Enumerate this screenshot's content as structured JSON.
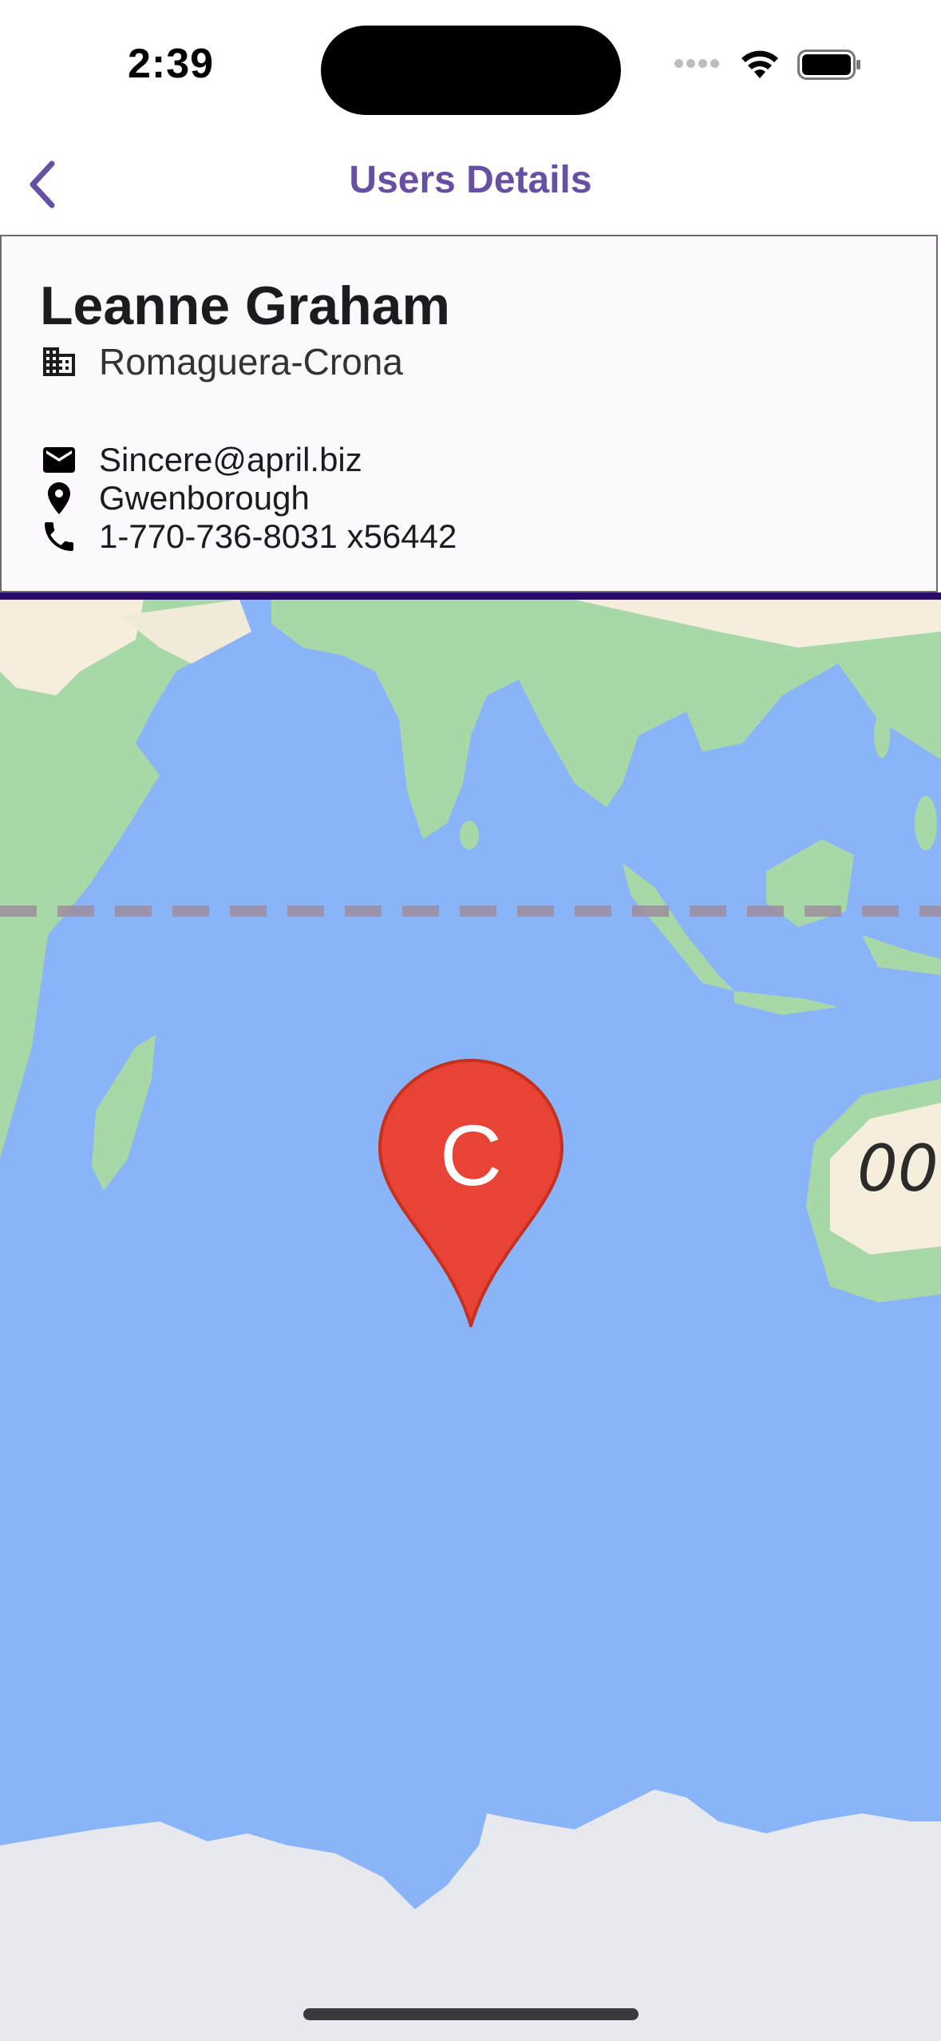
{
  "status_bar": {
    "time": "2:39"
  },
  "nav": {
    "title": "Users Details",
    "back_icon": "chevron-left-icon"
  },
  "user": {
    "name": "Leanne Graham",
    "company": "Romaguera-Crona",
    "email": "Sincere@april.biz",
    "city": "Gwenborough",
    "phone": "1-770-736-8031 x56442"
  },
  "map": {
    "marker_label": "C",
    "tile_text": "00",
    "colors": {
      "water": "#8ab4f8",
      "land": "#a8d8a8",
      "desert": "#f5eedc",
      "ice": "#e8e9ee",
      "marker": "#e84335"
    }
  },
  "colors": {
    "accent": "#6750a4",
    "card_bg": "#fdf7fe",
    "card_bottom": "#2a0a6b"
  }
}
